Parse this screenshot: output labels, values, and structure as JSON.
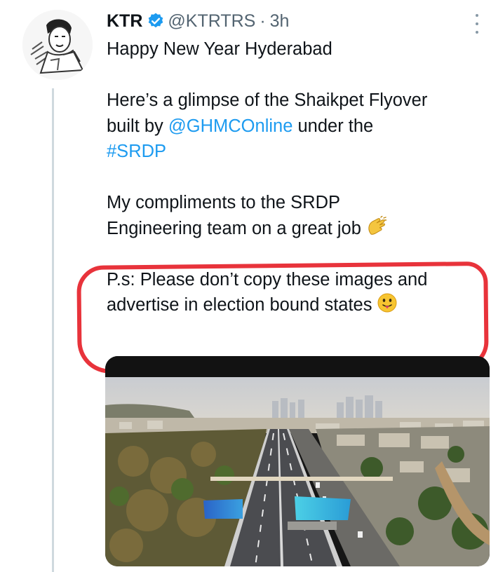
{
  "tweet": {
    "author_name": "KTR",
    "handle": "@KTRTRS",
    "separator": "·",
    "time": "3h",
    "verified": true,
    "avatar": "avatar-sketch-icon",
    "lines": {
      "l1": "Happy New Year Hyderabad",
      "l2": "Here’s a glimpse of the Shaikpet Flyover",
      "l3_pre": "built by ",
      "l3_link": "@GHMCOnline",
      "l3_post": " under the",
      "l4_hashtag": "#SRDP",
      "l5": "My compliments to the SRDP",
      "l6": "Engineering team on a great job",
      "l7": "P.s: Please don’t copy these images and",
      "l8": "advertise in election bound states"
    },
    "emojis": [
      "clapping-hands-icon",
      "tongue-out-face-icon"
    ],
    "media": "flyover-aerial-photo"
  },
  "colors": {
    "link": "#1d9bf0",
    "verified": "#1d9bf0",
    "annotation": "#e8333b",
    "muted": "#536471"
  }
}
